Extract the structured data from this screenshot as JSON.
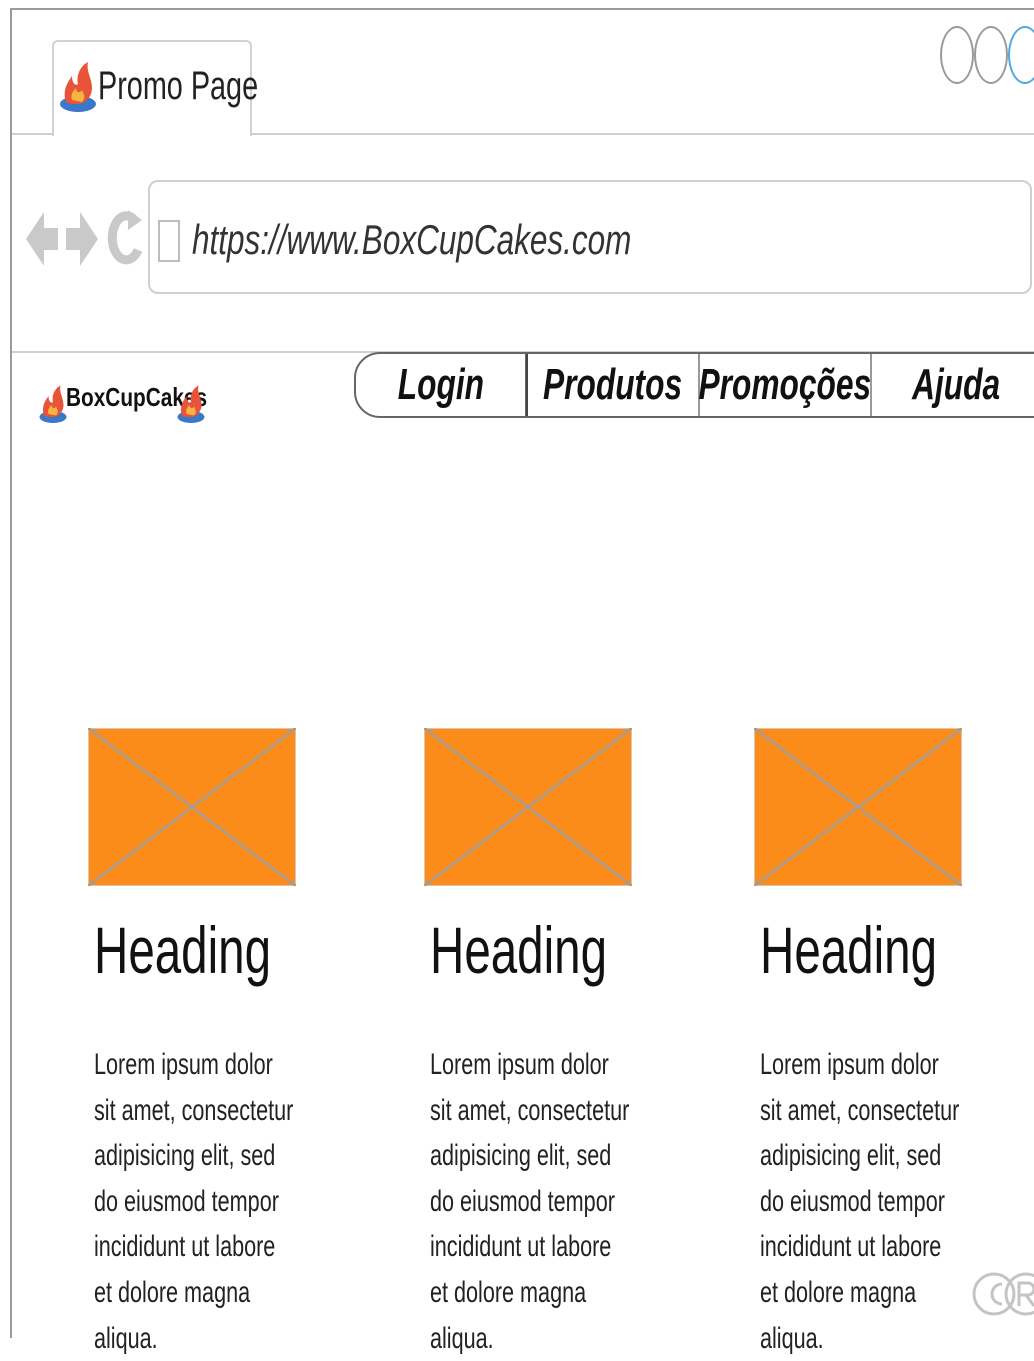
{
  "browser": {
    "tab_title": "Promo Page",
    "url": "https://www.BoxCupCakes.com"
  },
  "site": {
    "brand_name": "BoxCupCakes",
    "nav": {
      "login": "Login",
      "produtos": "Produtos",
      "promocoes": "Promoções",
      "ajuda": "Ajuda"
    }
  },
  "promos": [
    {
      "heading": "Heading",
      "text": "Lorem ipsum dolor sit amet, consectetur adipisicing elit, sed do eiusmod tempor incididunt ut labore et dolore magna aliqua."
    },
    {
      "heading": "Heading",
      "text": "Lorem ipsum dolor sit amet, consectetur adipisicing elit, sed do eiusmod tempor incididunt ut labore et dolore magna aliqua."
    },
    {
      "heading": "Heading",
      "text": "Lorem ipsum dolor sit amet, consectetur adipisicing elit, sed do eiusmod tempor incididunt ut labore et dolore magna aliqua."
    }
  ],
  "colors": {
    "image_placeholder": "#fb8c1a",
    "placeholder_cross": "#b29a82",
    "accent_blue": "#4fa8df"
  },
  "icons": {
    "tab_icon": "flame-logo-icon",
    "back": "back-arrow-icon",
    "forward": "forward-arrow-icon",
    "reload": "reload-icon",
    "page": "page-icon",
    "watermark": "copyright-registered-icon"
  }
}
